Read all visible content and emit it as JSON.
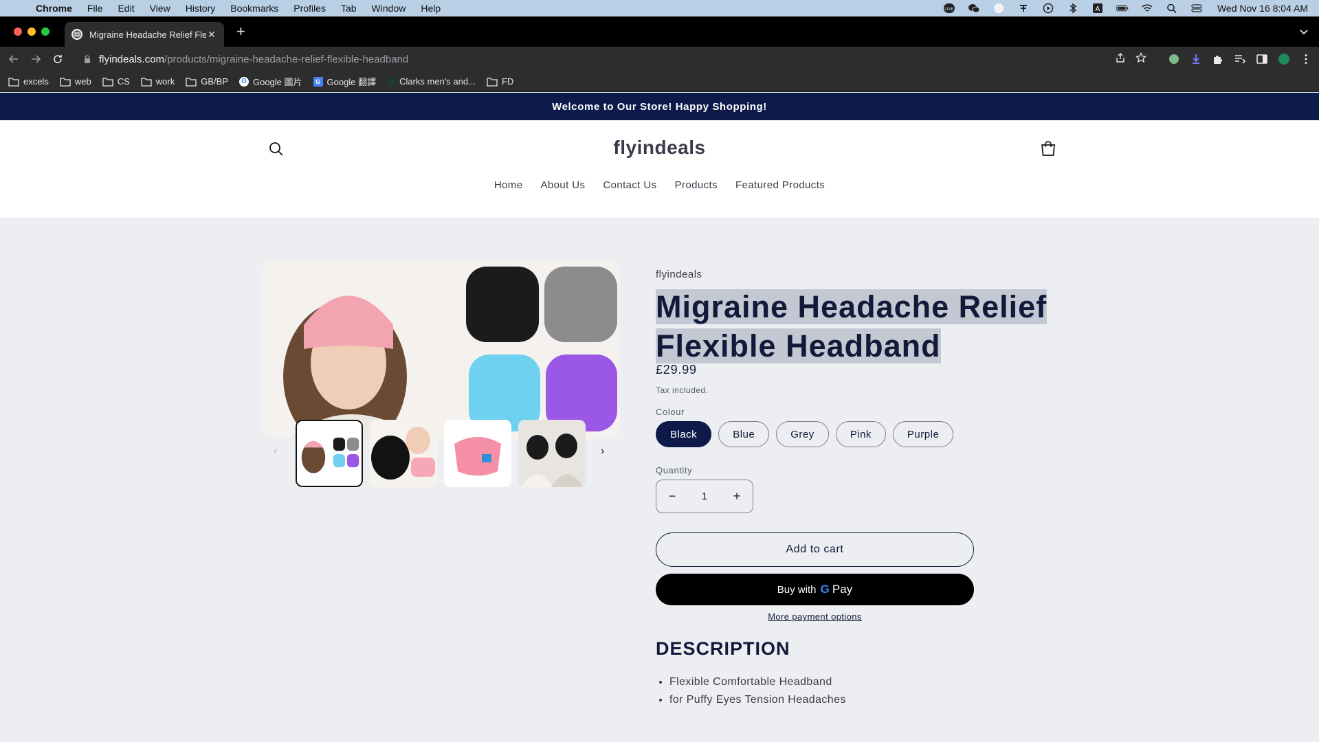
{
  "menubar": {
    "app": "Chrome",
    "items": [
      "File",
      "Edit",
      "View",
      "History",
      "Bookmarks",
      "Profiles",
      "Tab",
      "Window",
      "Help"
    ],
    "clock": "Wed Nov 16  8:04 AM"
  },
  "browser": {
    "tab_title": "Migraine Headache Relief Flexi",
    "url_host": "flyindeals.com",
    "url_path": "/products/migraine-headache-relief-flexible-headband",
    "bookmarks": [
      "excels",
      "web",
      "CS",
      "work",
      "GB/BP",
      "Google 圖片",
      "Google 翻譯",
      "Clarks men's and...",
      "FD"
    ]
  },
  "store": {
    "announcement": "Welcome to Our Store! Happy Shopping!",
    "logo": "flyindeals",
    "nav": [
      "Home",
      "About Us",
      "Contact Us",
      "Products",
      "Featured Products"
    ]
  },
  "product": {
    "vendor": "flyindeals",
    "title_line1": "Migraine Headache Relief",
    "title_line2": "Flexible Headband",
    "price": "£29.99",
    "tax_note": "Tax included.",
    "colour_label": "Colour",
    "colours": [
      "Black",
      "Blue",
      "Grey",
      "Pink",
      "Purple"
    ],
    "selected_colour": "Black",
    "quantity_label": "Quantity",
    "quantity": "1",
    "add_to_cart": "Add to cart",
    "buy_with": "Buy with",
    "gpay_g": "G",
    "gpay_pay": "Pay",
    "more_payment": "More payment options",
    "description_heading": "DESCRIPTION",
    "description_items": [
      "Flexible Comfortable Headband",
      "for Puffy Eyes Tension Headaches"
    ],
    "colors": {
      "accent": "#0e1a4a",
      "title_highlight": "#c4c8d3"
    }
  }
}
